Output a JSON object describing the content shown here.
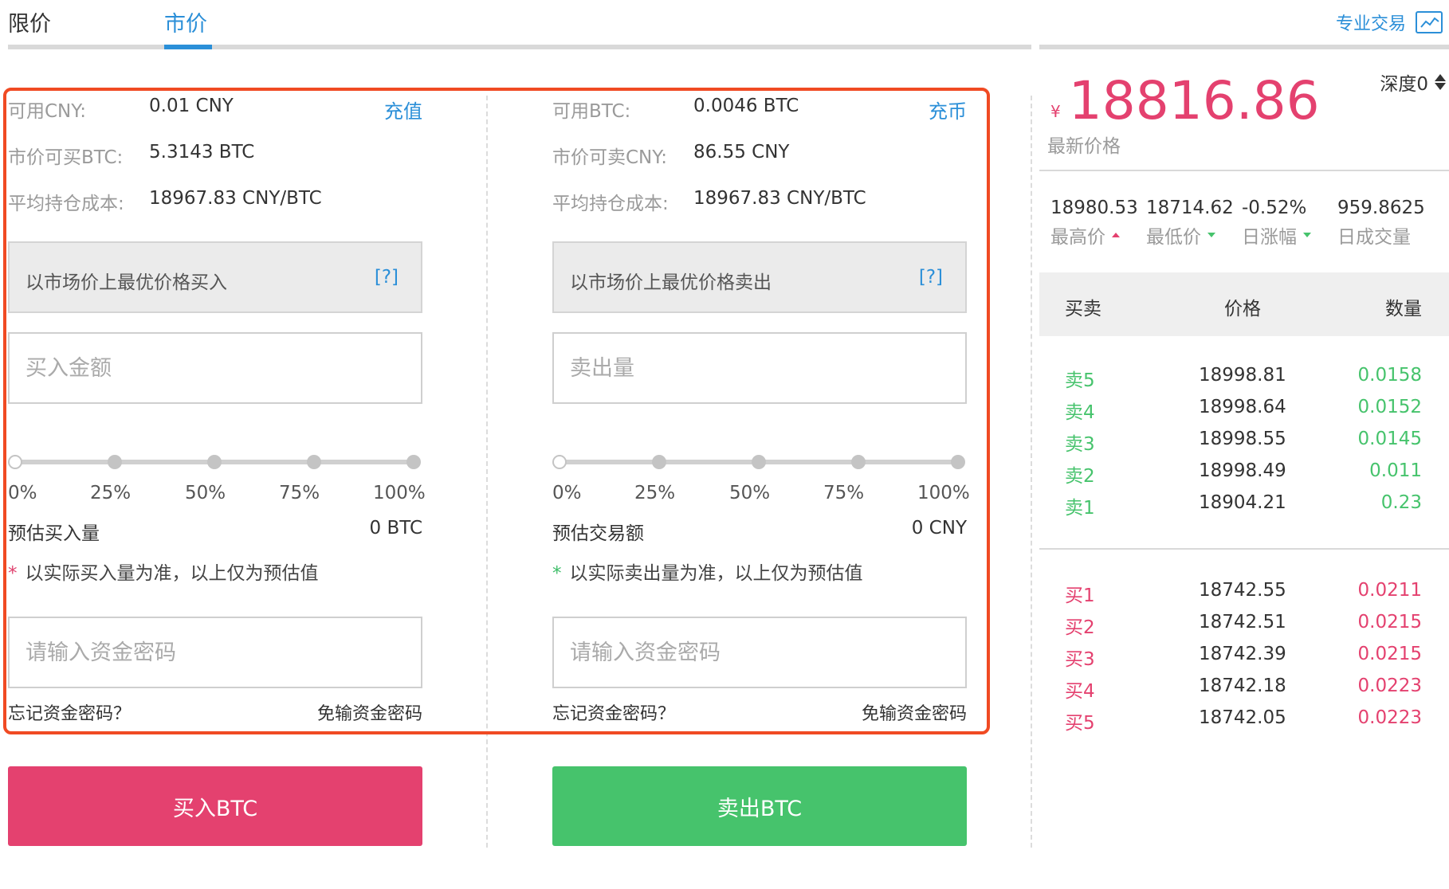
{
  "tabs": {
    "limit": "限价",
    "market": "市价"
  },
  "pro_trade": "专业交易",
  "buy_panel": {
    "rows": [
      {
        "label": "可用CNY:",
        "value": "0.01 CNY",
        "action": "充值"
      },
      {
        "label": "市价可买BTC:",
        "value": "5.3143 BTC"
      },
      {
        "label": "平均持仓成本:",
        "value": "18967.83 CNY/BTC"
      }
    ],
    "market_note": "以市场价上最优价格买入",
    "help": "[?]",
    "amount_placeholder": "买入金额",
    "percent_labels": [
      "0%",
      "25%",
      "50%",
      "75%",
      "100%"
    ],
    "estimate_label": "预估买入量",
    "estimate_value": "0 BTC",
    "disclaimer_star": "*",
    "disclaimer": "以实际买入量为准，以上仅为预估值",
    "password_placeholder": "请输入资金密码",
    "forgot_password": "忘记资金密码？",
    "no_password": "免输资金密码",
    "submit": "买入BTC"
  },
  "sell_panel": {
    "rows": [
      {
        "label": "可用BTC:",
        "value": "0.0046 BTC",
        "action": "充币"
      },
      {
        "label": "市价可卖CNY:",
        "value": "86.55 CNY"
      },
      {
        "label": "平均持仓成本:",
        "value": "18967.83 CNY/BTC"
      }
    ],
    "market_note": "以市场价上最优价格卖出",
    "help": "[?]",
    "amount_placeholder": "卖出量",
    "percent_labels": [
      "0%",
      "25%",
      "50%",
      "75%",
      "100%"
    ],
    "estimate_label": "预估交易额",
    "estimate_value": "0 CNY",
    "disclaimer_star": "*",
    "disclaimer": "以实际卖出量为准，以上仅为预估值",
    "password_placeholder": "请输入资金密码",
    "forgot_password": "忘记资金密码？",
    "no_password": "免输资金密码",
    "submit": "卖出BTC"
  },
  "market": {
    "depth_label": "深度0",
    "currency_symbol": "¥",
    "last_price": "18816.86",
    "last_price_label": "最新价格",
    "stats": [
      {
        "value": "18980.53",
        "label": "最高价"
      },
      {
        "value": "18714.62",
        "label": "最低价"
      },
      {
        "value": "-0.52%",
        "label": "日涨幅"
      },
      {
        "value": "959.8625",
        "label": "日成交量"
      }
    ],
    "orderbook_headers": {
      "side": "买卖",
      "price": "价格",
      "amount": "数量"
    },
    "asks": [
      {
        "side": "卖5",
        "price": "18998.81",
        "amount": "0.0158"
      },
      {
        "side": "卖4",
        "price": "18998.64",
        "amount": "0.0152"
      },
      {
        "side": "卖3",
        "price": "18998.55",
        "amount": "0.0145"
      },
      {
        "side": "卖2",
        "price": "18998.49",
        "amount": "0.011"
      },
      {
        "side": "卖1",
        "price": "18904.21",
        "amount": "0.23"
      }
    ],
    "bids": [
      {
        "side": "买1",
        "price": "18742.55",
        "amount": "0.0211"
      },
      {
        "side": "买2",
        "price": "18742.51",
        "amount": "0.0215"
      },
      {
        "side": "买3",
        "price": "18742.39",
        "amount": "0.0215"
      },
      {
        "side": "买4",
        "price": "18742.18",
        "amount": "0.0223"
      },
      {
        "side": "买5",
        "price": "18742.05",
        "amount": "0.0223"
      }
    ]
  },
  "colors": {
    "accent": "#2b8fd8",
    "buy": "#e4416f",
    "sell": "#46c36c",
    "highlight": "#f04a23"
  }
}
